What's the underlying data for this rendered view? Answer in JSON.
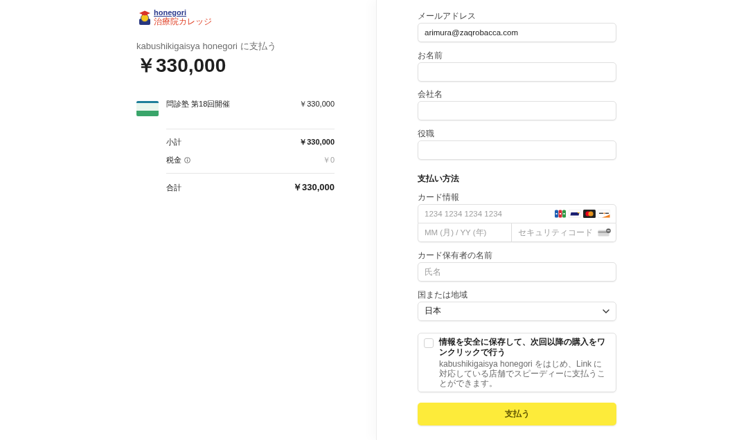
{
  "merchant": {
    "logo": {
      "name": "honegori",
      "tagline": "治療院カレッジ"
    },
    "pay_to": "kabushikigaisya honegori に支払う",
    "amount": "￥330,000"
  },
  "line_items": [
    {
      "name": "問診塾 第18回開催",
      "price": "￥330,000"
    }
  ],
  "summary": [
    {
      "kind": "subtotal",
      "label": "小計",
      "value": "￥330,000"
    },
    {
      "kind": "tax",
      "label": "税金",
      "value": "￥0"
    },
    {
      "kind": "total",
      "label": "合計",
      "value": "￥330,000"
    }
  ],
  "contact_fields": [
    {
      "label": "メールアドレス",
      "value": "arimura@zaqrobacca.com"
    },
    {
      "label": "お名前"
    },
    {
      "label": "会社名"
    },
    {
      "label": "役職"
    }
  ],
  "payment": {
    "heading": "支払い方法",
    "card": {
      "label": "カード情報",
      "number_placeholder": "1234 1234 1234 1234",
      "expiry_placeholder": "MM (月) / YY (年)",
      "cvc_placeholder": "セキュリティコード"
    },
    "cardholder": {
      "label": "カード保有者の名前",
      "placeholder": "氏名"
    },
    "country": {
      "label": "国または地域",
      "value": "日本"
    }
  },
  "save_info": {
    "checked": false,
    "title": "情報を安全に保存して、次回以降の購入をワンクリックで行う",
    "description": "kabushikigaisya honegori をはじめ、Link に対応している店舗でスピーディーに支払うことができます。"
  },
  "pay_button": "支払う"
}
